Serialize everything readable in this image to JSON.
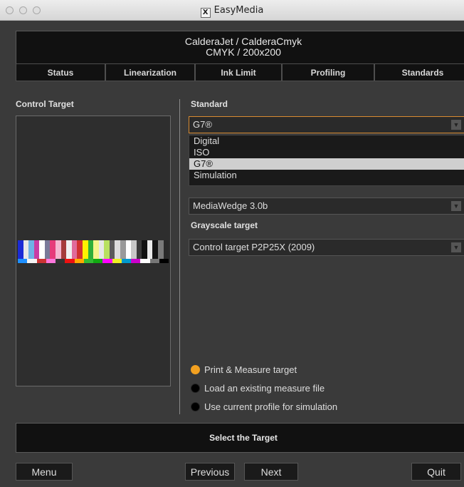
{
  "window": {
    "title": "EasyMedia",
    "icon": "x11-icon"
  },
  "header": {
    "line1": "CalderaJet / CalderaCmyk",
    "line2": "CMYK / 200x200"
  },
  "tabs": [
    {
      "label": "Status"
    },
    {
      "label": "Linearization"
    },
    {
      "label": "Ink Limit"
    },
    {
      "label": "Profiling"
    },
    {
      "label": "Standards"
    }
  ],
  "left_panel": {
    "title": "Control Target"
  },
  "standard": {
    "label": "Standard",
    "selected": "G7®",
    "options": [
      "Digital",
      "ISO",
      "G7®",
      "Simulation"
    ],
    "selected_index": 2
  },
  "measure_target": {
    "value": "MediaWedge 3.0b"
  },
  "grayscale": {
    "label": "Grayscale target",
    "value": "Control target P2P25X (2009)"
  },
  "radio_options": [
    {
      "label": "Print & Measure target",
      "selected": true
    },
    {
      "label": "Load an existing measure file",
      "selected": false
    },
    {
      "label": "Use current profile for simulation",
      "selected": false
    }
  ],
  "bottom": {
    "message": "Select the Target"
  },
  "buttons": {
    "menu": "Menu",
    "previous": "Previous",
    "next": "Next",
    "quit": "Quit"
  },
  "colors": {
    "accent": "#f2a020",
    "background": "#3a3a3a",
    "panel": "#111111"
  }
}
